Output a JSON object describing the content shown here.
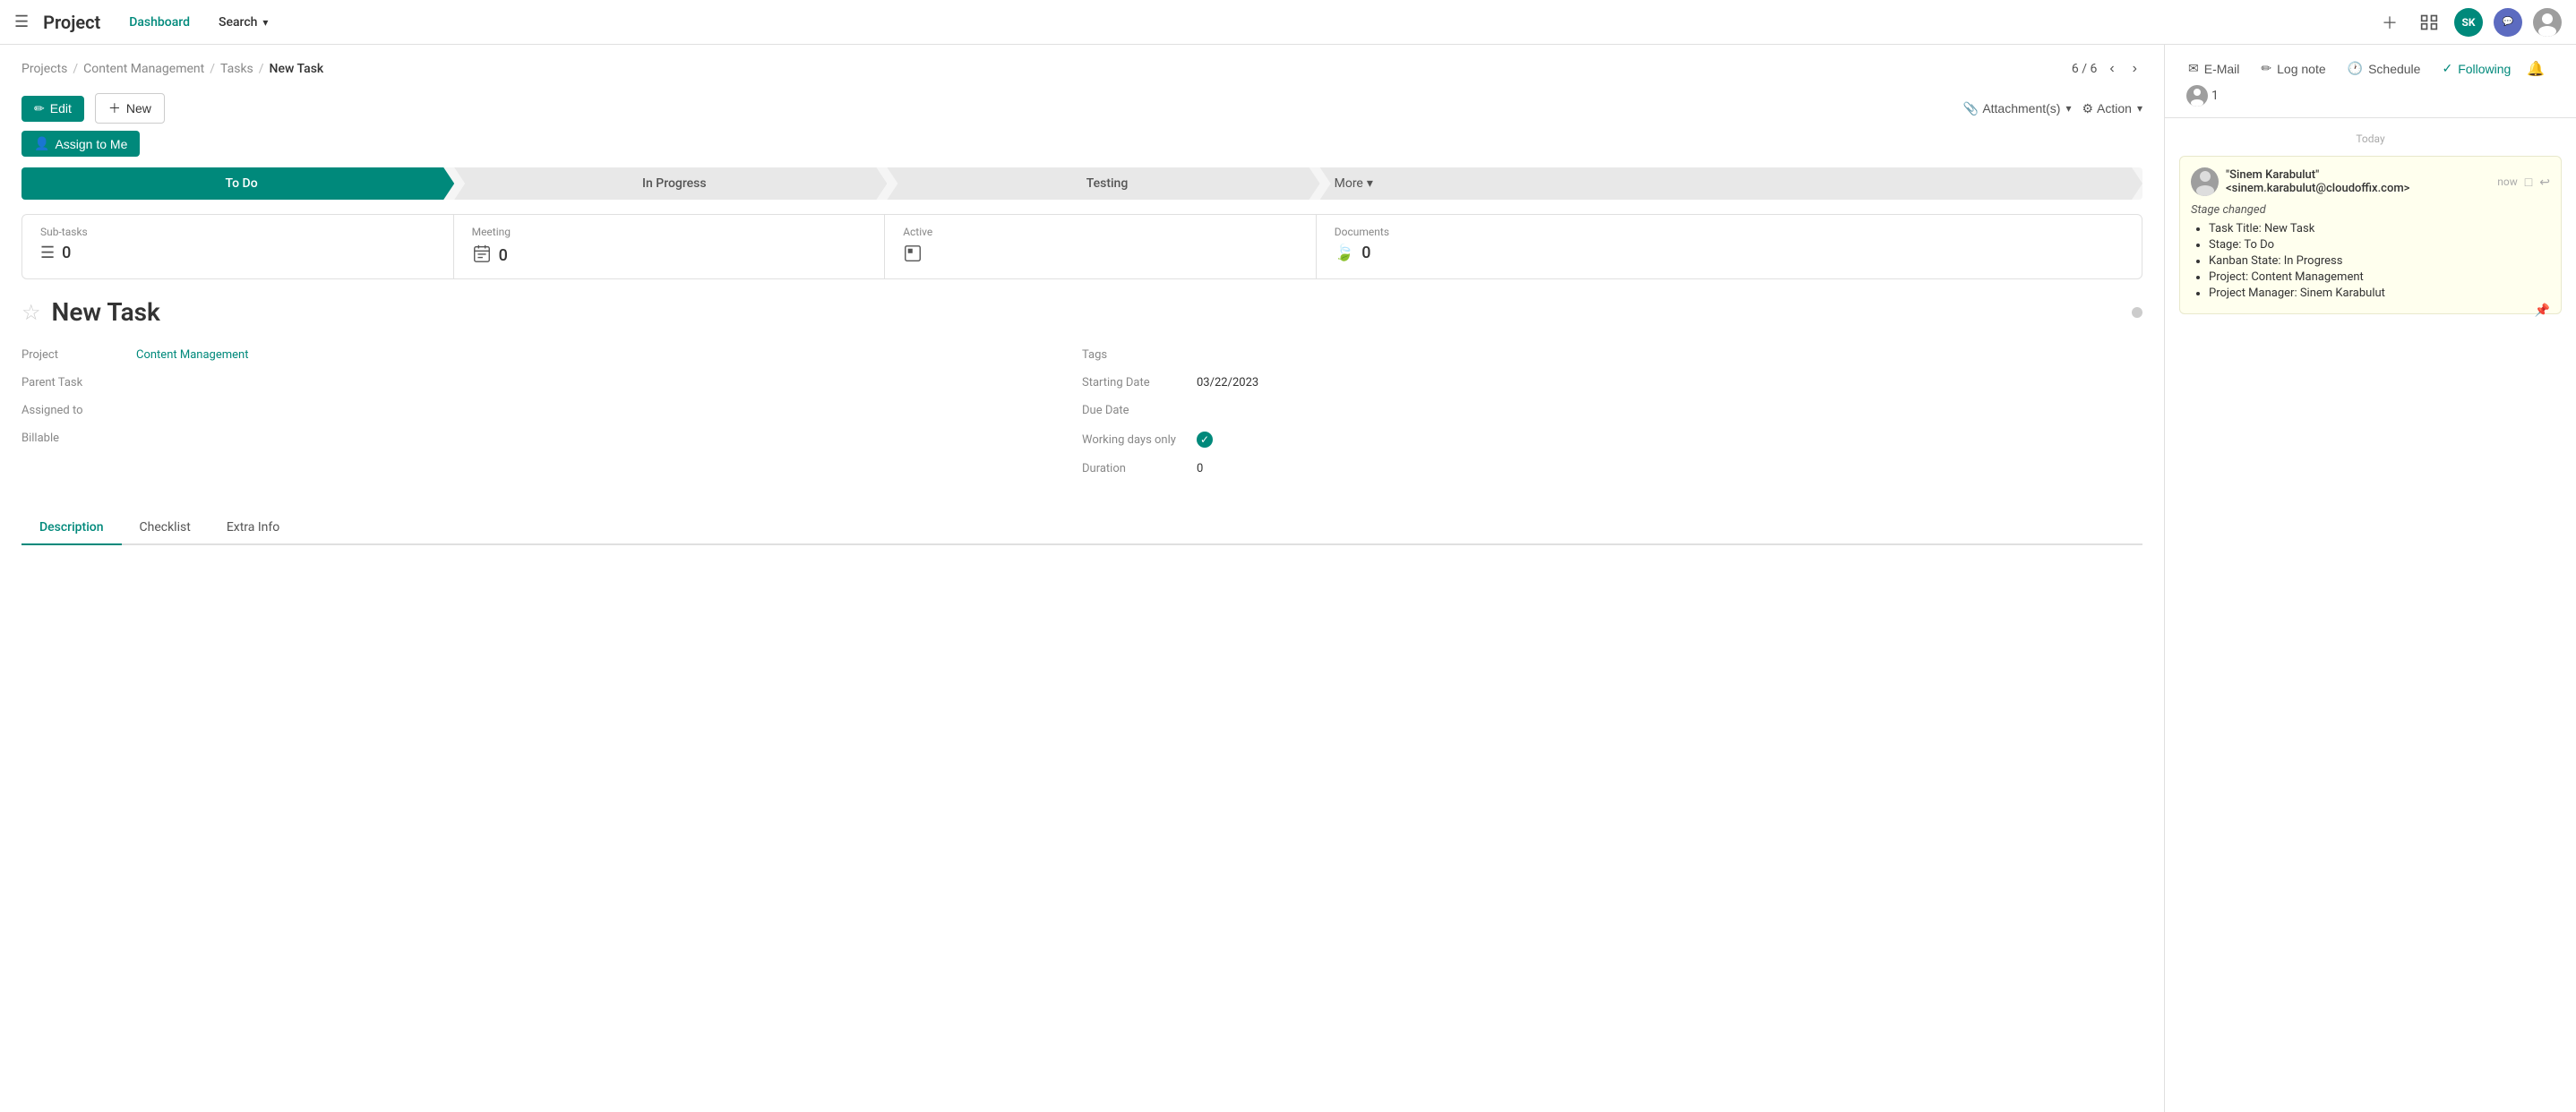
{
  "app": {
    "title": "Project",
    "nav_links": [
      "Dashboard",
      "Search"
    ]
  },
  "header": {
    "dashboard_label": "Dashboard",
    "search_label": "Search",
    "search_chevron": "▾"
  },
  "breadcrumb": {
    "items": [
      "Projects",
      "Content Management",
      "Tasks",
      "New Task"
    ],
    "separators": [
      "/",
      "/",
      "/"
    ]
  },
  "pagination": {
    "current": "6 / 6"
  },
  "toolbar": {
    "edit_label": "Edit",
    "new_label": "New",
    "assign_me_label": "Assign to Me",
    "attachments_label": "Attachment(s)",
    "action_label": "Action"
  },
  "stages": [
    {
      "id": "todo",
      "label": "To Do",
      "active": true
    },
    {
      "id": "inprogress",
      "label": "In Progress",
      "active": false
    },
    {
      "id": "testing",
      "label": "Testing",
      "active": false
    },
    {
      "id": "more",
      "label": "More",
      "active": false
    }
  ],
  "stats": [
    {
      "id": "subtasks",
      "label": "Sub-tasks",
      "icon": "☰",
      "value": "0"
    },
    {
      "id": "meeting",
      "label": "Meeting",
      "icon": "▦",
      "value": "0"
    },
    {
      "id": "active",
      "label": "Active",
      "icon": "◫",
      "value": ""
    },
    {
      "id": "documents",
      "label": "Documents",
      "icon": "🍃",
      "value": "0"
    }
  ],
  "task": {
    "title": "New Task",
    "project_label": "Project",
    "project_value": "Content Management",
    "parent_task_label": "Parent Task",
    "parent_task_value": "",
    "assigned_to_label": "Assigned to",
    "assigned_to_value": "",
    "billable_label": "Billable",
    "billable_value": "",
    "tags_label": "Tags",
    "tags_value": "",
    "starting_date_label": "Starting Date",
    "starting_date_value": "03/22/2023",
    "due_date_label": "Due Date",
    "due_date_value": "",
    "working_days_label": "Working days only",
    "working_days_value": "checked",
    "duration_label": "Duration",
    "duration_value": "0"
  },
  "tabs": [
    {
      "id": "description",
      "label": "Description",
      "active": true
    },
    {
      "id": "checklist",
      "label": "Checklist",
      "active": false
    },
    {
      "id": "extra_info",
      "label": "Extra Info",
      "active": false
    }
  ],
  "chatter": {
    "email_label": "E-Mail",
    "log_note_label": "Log note",
    "schedule_label": "Schedule",
    "following_label": "Following",
    "followers_count": "1",
    "today_label": "Today",
    "messages": [
      {
        "id": "msg1",
        "sender": "\"Sinem Karabulut\" <sinem.karabulut@cloudoffix.com>",
        "time": "now",
        "type": "Stage changed",
        "body_items": [
          "Task Title: New Task",
          "Stage: To Do",
          "Kanban State: In Progress",
          "Project: Content Management",
          "Project Manager: Sinem Karabulut"
        ]
      }
    ]
  }
}
